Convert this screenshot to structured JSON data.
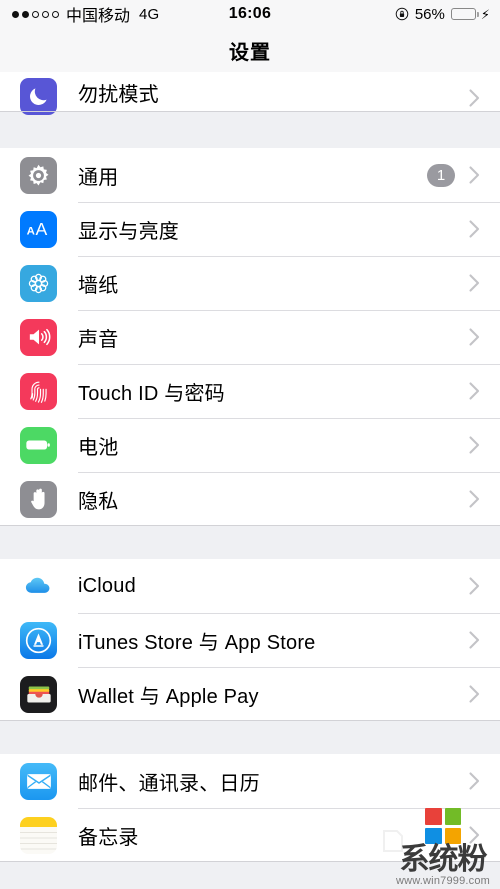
{
  "status_bar": {
    "signal_dots_filled": 2,
    "signal_dots_total": 5,
    "carrier": "中国移动",
    "network": "4G",
    "time": "16:06",
    "battery_percent": "56%",
    "battery_level": 56,
    "battery_color": "#ffcc00",
    "lock_icon": "rotation-lock-icon",
    "charging_icon": "⚡",
    "is_charging": true
  },
  "nav": {
    "title": "设置"
  },
  "sections": [
    {
      "id": "notifications-group",
      "clipped_top": true,
      "rows": [
        {
          "id": "do-not-disturb",
          "label": "勿扰模式",
          "icon": "moon-icon",
          "icon_bg": "#5856d6",
          "badge": null,
          "clipped": true
        }
      ]
    },
    {
      "id": "system-group",
      "clipped_top": false,
      "rows": [
        {
          "id": "general",
          "label": "通用",
          "icon": "gear-icon",
          "icon_bg": "#8e8e93",
          "badge": "1"
        },
        {
          "id": "display",
          "label": "显示与亮度",
          "icon": "text-size-icon",
          "icon_bg": "#007aff",
          "badge": null
        },
        {
          "id": "wallpaper",
          "label": "墙纸",
          "icon": "flower-icon",
          "icon_bg": "#36a8e0",
          "badge": null
        },
        {
          "id": "sounds",
          "label": "声音",
          "icon": "speaker-icon",
          "icon_bg": "#f4395b",
          "badge": null
        },
        {
          "id": "touch-id",
          "label": "Touch ID 与密码",
          "icon": "fingerprint-icon",
          "icon_bg": "#f4395b",
          "badge": null
        },
        {
          "id": "battery",
          "label": "电池",
          "icon": "battery-icon",
          "icon_bg": "#4cd964",
          "badge": null
        },
        {
          "id": "privacy",
          "label": "隐私",
          "icon": "hand-icon",
          "icon_bg": "#8e8e93",
          "badge": null
        }
      ]
    },
    {
      "id": "accounts-group",
      "clipped_top": false,
      "rows": [
        {
          "id": "icloud",
          "label": "iCloud",
          "icon": "cloud-icon",
          "icon_bg": "#ffffff",
          "badge": null
        },
        {
          "id": "itunes-store",
          "label": "iTunes Store 与 App Store",
          "icon": "appstore-icon",
          "icon_bg": "#1d9bf5",
          "badge": null
        },
        {
          "id": "wallet",
          "label": "Wallet 与 Apple Pay",
          "icon": "wallet-icon",
          "icon_bg": "#1c1c1e",
          "badge": null
        }
      ]
    },
    {
      "id": "apps-group",
      "clipped_top": false,
      "rows": [
        {
          "id": "mail",
          "label": "邮件、通讯录、日历",
          "icon": "mail-icon",
          "icon_bg": "#29a9f4",
          "badge": null
        },
        {
          "id": "notes",
          "label": "备忘录",
          "icon": "notes-icon",
          "icon_bg": "#ffffff",
          "badge": null
        }
      ]
    }
  ],
  "watermark": {
    "text": "系统粉",
    "url": "www.win7999.com",
    "logo_colors": [
      "#e8413a",
      "#72bb27",
      "#0f8fe3",
      "#f4a400"
    ]
  }
}
